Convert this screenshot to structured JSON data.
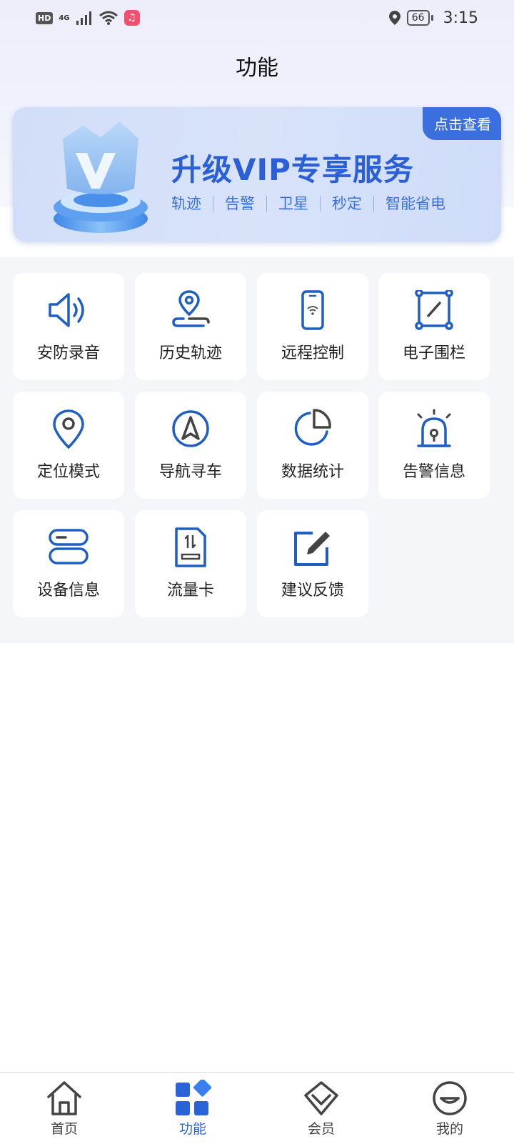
{
  "status_bar": {
    "hd": "HD",
    "network": "4G",
    "battery": "66",
    "time": "3:15"
  },
  "header": {
    "title": "功能"
  },
  "vip_banner": {
    "badge": "点击查看",
    "title": "升级VIP专享服务",
    "features": [
      "轨迹",
      "告警",
      "卫星",
      "秒定",
      "智能省电"
    ]
  },
  "functions": [
    {
      "label": "安防录音",
      "icon": "speaker-icon"
    },
    {
      "label": "历史轨迹",
      "icon": "location-track-icon"
    },
    {
      "label": "远程控制",
      "icon": "phone-remote-icon"
    },
    {
      "label": "电子围栏",
      "icon": "fence-icon"
    },
    {
      "label": "定位模式",
      "icon": "location-pin-icon"
    },
    {
      "label": "导航寻车",
      "icon": "navigation-icon"
    },
    {
      "label": "数据统计",
      "icon": "pie-chart-icon"
    },
    {
      "label": "告警信息",
      "icon": "alarm-icon"
    },
    {
      "label": "设备信息",
      "icon": "device-icon"
    },
    {
      "label": "流量卡",
      "icon": "sim-card-icon"
    },
    {
      "label": "建议反馈",
      "icon": "feedback-edit-icon"
    }
  ],
  "bottom_nav": [
    {
      "label": "首页",
      "icon": "home-icon",
      "active": false
    },
    {
      "label": "功能",
      "icon": "function-grid-icon",
      "active": true
    },
    {
      "label": "会员",
      "icon": "member-icon",
      "active": false
    },
    {
      "label": "我的",
      "icon": "profile-icon",
      "active": false
    }
  ],
  "colors": {
    "accent": "#2a62d8",
    "icon_blue": "#1f5fc4",
    "tile_bg": "#ffffff",
    "grid_bg": "#f5f6f9"
  }
}
